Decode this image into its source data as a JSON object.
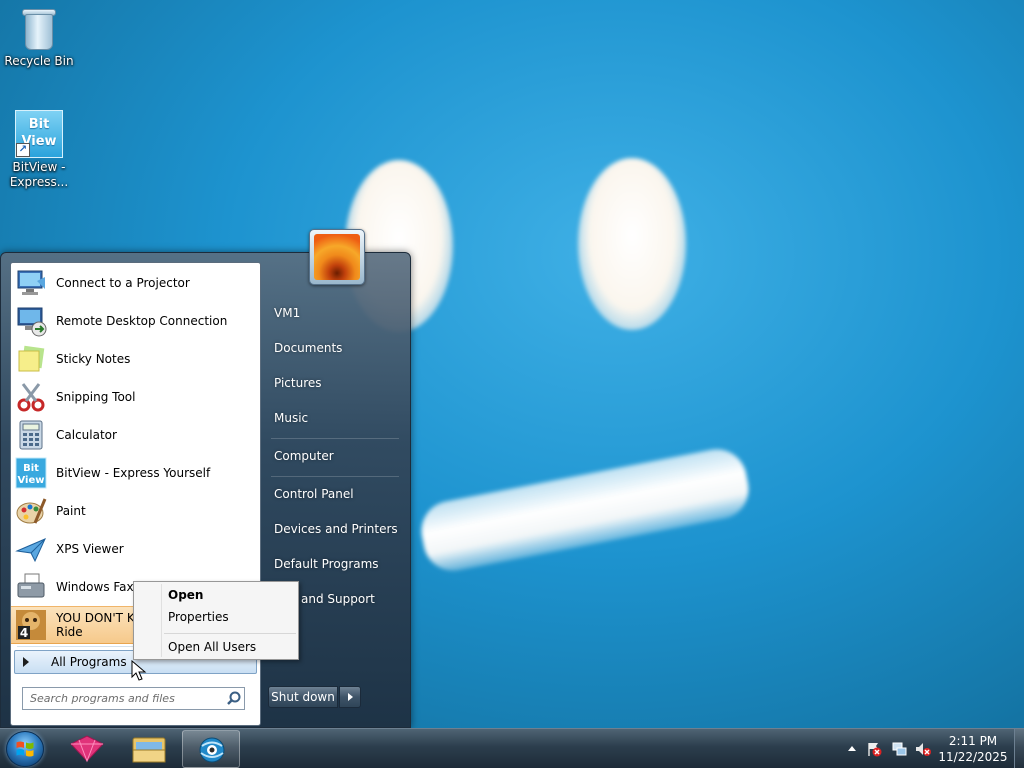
{
  "desktop": {
    "icons": [
      {
        "label": "Recycle Bin"
      },
      {
        "label_line1": "BitView -",
        "label_line2": "Express...",
        "tile_line1": "Bit",
        "tile_line2": "View"
      }
    ]
  },
  "start_menu": {
    "programs": [
      {
        "label": "Connect to a Projector",
        "icon": "projector-icon"
      },
      {
        "label": "Remote Desktop Connection",
        "icon": "remote-desktop-icon"
      },
      {
        "label": "Sticky Notes",
        "icon": "sticky-notes-icon"
      },
      {
        "label": "Snipping Tool",
        "icon": "scissors-icon"
      },
      {
        "label": "Calculator",
        "icon": "calculator-icon"
      },
      {
        "label": "BitView - Express Yourself",
        "icon": "bitview-icon",
        "tile": "Bit View"
      },
      {
        "label": "Paint",
        "icon": "paint-palette-icon"
      },
      {
        "label": "XPS Viewer",
        "icon": "xps-viewer-icon"
      },
      {
        "label": "Windows Fax and S",
        "icon": "fax-icon"
      },
      {
        "label_line1": "YOU DON'T KN",
        "label_line2": "Ride",
        "icon": "game-4-icon",
        "badge": "4"
      }
    ],
    "all_programs": "All Programs",
    "search_placeholder": "Search programs and files",
    "right_items": [
      "VM1",
      "Documents",
      "Pictures",
      "Music",
      "Computer",
      "Control Panel",
      "Devices and Printers",
      "Default Programs",
      "and Support"
    ],
    "shutdown": "Shut down"
  },
  "context_menu": {
    "items": [
      "Open",
      "Properties",
      "Open All Users"
    ]
  },
  "taskbar": {
    "time": "2:11 PM",
    "date": "11/22/2025"
  },
  "colors": {
    "highlight": "#f6c98b",
    "taskbar": "#2c3e4d",
    "desktop": "#1d93cf"
  }
}
